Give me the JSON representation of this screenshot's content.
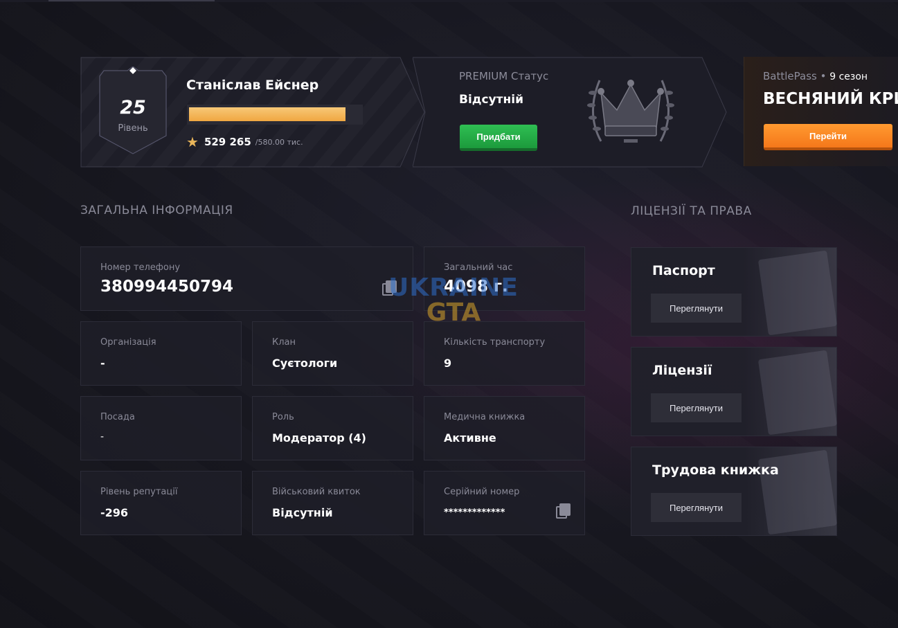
{
  "player": {
    "level": "25",
    "level_label": "Рівень",
    "name": "Станіслав Ейснер",
    "xp_progress": 0.912,
    "xp_value": "529 265",
    "xp_max": "/580.00 тис."
  },
  "premium": {
    "label": "PREMIUM Статус",
    "value": "Відсутній",
    "buy_label": "Придбати"
  },
  "battlepass": {
    "label": "BattlePass",
    "season": "9 сезон",
    "title": "ВЕСНЯНИЙ КРИ",
    "go_label": "Перейти"
  },
  "general": {
    "title": "ЗАГАЛЬНА ІНФОРМАЦІЯ",
    "phone": {
      "label": "Номер телефону",
      "value": "380994450794"
    },
    "total_time": {
      "label": "Загальний час",
      "value": "4098 г."
    },
    "organization": {
      "label": "Організація",
      "value": "-"
    },
    "clan": {
      "label": "Клан",
      "value": "Суєтологи"
    },
    "vehicles": {
      "label": "Кількість транспорту",
      "value": "9"
    },
    "position": {
      "label": "Посада",
      "value": "-"
    },
    "role": {
      "label": "Роль",
      "value": "Модератор (4)"
    },
    "medical": {
      "label": "Медична книжка",
      "value": "Активне"
    },
    "reputation": {
      "label": "Рівень репутації",
      "value": "-296"
    },
    "military": {
      "label": "Військовий квиток",
      "value": "Відсутній"
    },
    "serial": {
      "label": "Серійний номер",
      "value": "*************"
    }
  },
  "licenses": {
    "title": "ЛІЦЕНЗІЇ ТА ПРАВА",
    "items": [
      {
        "title": "Паспорт",
        "button": "Переглянути"
      },
      {
        "title": "Ліцензії",
        "button": "Переглянути"
      },
      {
        "title": "Трудова книжка",
        "button": "Переглянути"
      }
    ]
  },
  "watermark": {
    "line1": "UKRAINE",
    "line2": "GTA"
  },
  "colors": {
    "accent_green": "#1c9a3c",
    "accent_orange": "#f5781a",
    "xp_gold": "#f0a741"
  }
}
